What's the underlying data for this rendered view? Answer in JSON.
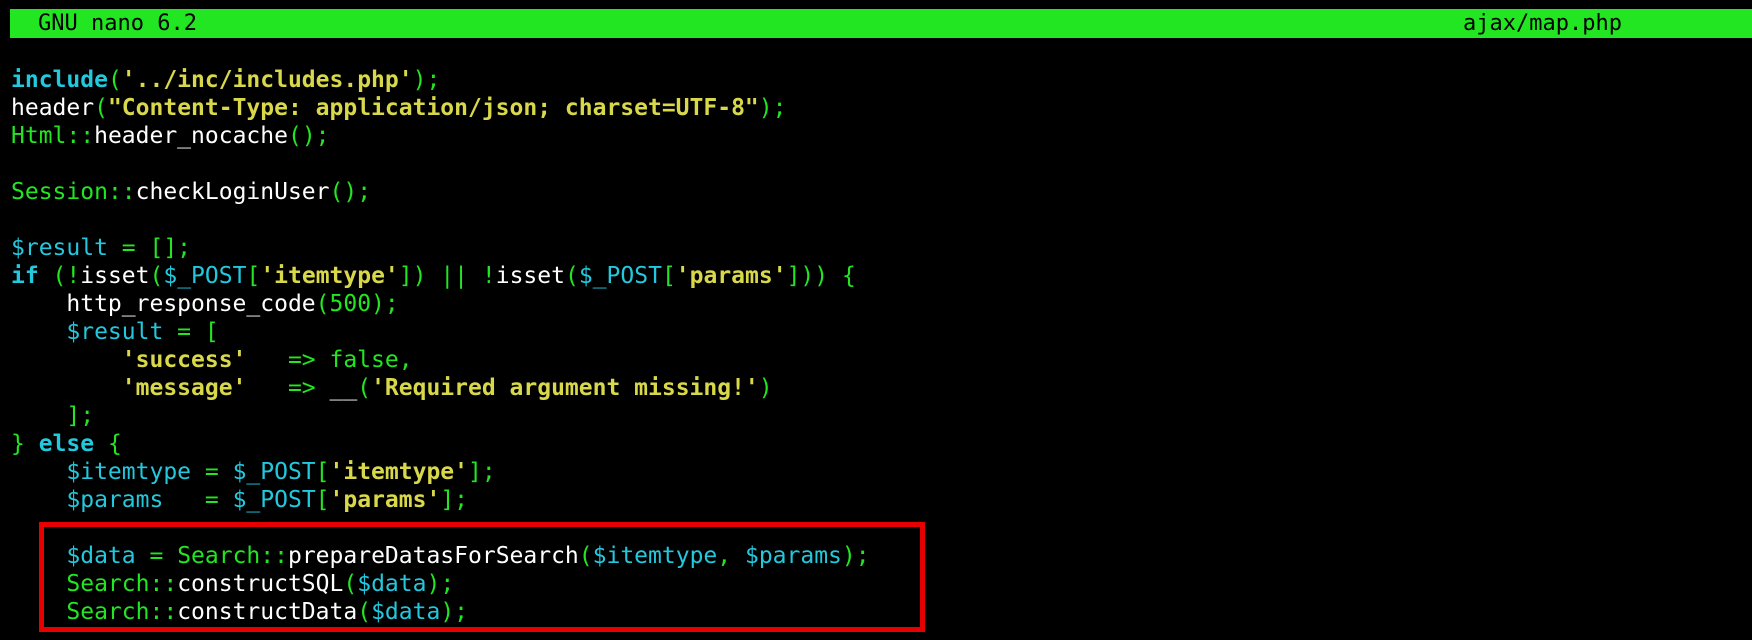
{
  "titlebar": {
    "app": "GNU nano 6.2",
    "filename": "ajax/map.php"
  },
  "colors": {
    "titlebar_bg": "#21e621",
    "keyword": "#22c9de",
    "variable": "#22c9de",
    "class": "#21e621",
    "string": "#d8d84a",
    "highlight_border": "#e60000"
  },
  "editor": {
    "lines": [
      [
        {
          "t": "include",
          "c": "kw"
        },
        {
          "t": "(",
          "c": "punc"
        },
        {
          "t": "'../inc/includes.php'",
          "c": "str"
        },
        {
          "t": ");",
          "c": "punc"
        }
      ],
      [
        {
          "t": "header",
          "c": "fn"
        },
        {
          "t": "(",
          "c": "punc"
        },
        {
          "t": "\"Content-Type: application/json; charset=UTF-8\"",
          "c": "str"
        },
        {
          "t": ");",
          "c": "punc"
        }
      ],
      [
        {
          "t": "Html",
          "c": "cls"
        },
        {
          "t": "::",
          "c": "punc"
        },
        {
          "t": "header_nocache",
          "c": "fn"
        },
        {
          "t": "();",
          "c": "punc"
        }
      ],
      [],
      [
        {
          "t": "Session",
          "c": "cls"
        },
        {
          "t": "::",
          "c": "punc"
        },
        {
          "t": "checkLoginUser",
          "c": "fn"
        },
        {
          "t": "();",
          "c": "punc"
        }
      ],
      [],
      [
        {
          "t": "$result",
          "c": "var"
        },
        {
          "t": " = [];",
          "c": "punc"
        }
      ],
      [
        {
          "t": "if",
          "c": "kw"
        },
        {
          "t": " (!",
          "c": "punc"
        },
        {
          "t": "isset",
          "c": "fn"
        },
        {
          "t": "(",
          "c": "punc"
        },
        {
          "t": "$_POST",
          "c": "var"
        },
        {
          "t": "[",
          "c": "punc"
        },
        {
          "t": "'itemtype'",
          "c": "str"
        },
        {
          "t": "]) || !",
          "c": "punc"
        },
        {
          "t": "isset",
          "c": "fn"
        },
        {
          "t": "(",
          "c": "punc"
        },
        {
          "t": "$_POST",
          "c": "var"
        },
        {
          "t": "[",
          "c": "punc"
        },
        {
          "t": "'params'",
          "c": "str"
        },
        {
          "t": "])) {",
          "c": "punc"
        }
      ],
      [
        {
          "t": "    ",
          "c": "fn"
        },
        {
          "t": "http_response_code",
          "c": "fn"
        },
        {
          "t": "(",
          "c": "punc"
        },
        {
          "t": "500",
          "c": "num"
        },
        {
          "t": ");",
          "c": "punc"
        }
      ],
      [
        {
          "t": "    ",
          "c": "fn"
        },
        {
          "t": "$result",
          "c": "var"
        },
        {
          "t": " = [",
          "c": "punc"
        }
      ],
      [
        {
          "t": "        ",
          "c": "fn"
        },
        {
          "t": "'success'",
          "c": "str"
        },
        {
          "t": "   => false,",
          "c": "punc"
        }
      ],
      [
        {
          "t": "        ",
          "c": "fn"
        },
        {
          "t": "'message'",
          "c": "str"
        },
        {
          "t": "   => ",
          "c": "punc"
        },
        {
          "t": "__",
          "c": "fn"
        },
        {
          "t": "(",
          "c": "punc"
        },
        {
          "t": "'Required argument missing!'",
          "c": "str"
        },
        {
          "t": ")",
          "c": "punc"
        }
      ],
      [
        {
          "t": "    ];",
          "c": "punc"
        }
      ],
      [
        {
          "t": "} ",
          "c": "punc"
        },
        {
          "t": "else",
          "c": "kw"
        },
        {
          "t": " {",
          "c": "punc"
        }
      ],
      [
        {
          "t": "    ",
          "c": "fn"
        },
        {
          "t": "$itemtype",
          "c": "var"
        },
        {
          "t": " = ",
          "c": "punc"
        },
        {
          "t": "$_POST",
          "c": "var"
        },
        {
          "t": "[",
          "c": "punc"
        },
        {
          "t": "'itemtype'",
          "c": "str"
        },
        {
          "t": "];",
          "c": "punc"
        }
      ],
      [
        {
          "t": "    ",
          "c": "fn"
        },
        {
          "t": "$params",
          "c": "var"
        },
        {
          "t": "   = ",
          "c": "punc"
        },
        {
          "t": "$_POST",
          "c": "var"
        },
        {
          "t": "[",
          "c": "punc"
        },
        {
          "t": "'params'",
          "c": "str"
        },
        {
          "t": "];",
          "c": "punc"
        }
      ],
      [],
      [
        {
          "t": "    ",
          "c": "fn"
        },
        {
          "t": "$data",
          "c": "var"
        },
        {
          "t": " = ",
          "c": "punc"
        },
        {
          "t": "Search",
          "c": "cls"
        },
        {
          "t": "::",
          "c": "punc"
        },
        {
          "t": "prepareDatasForSearch",
          "c": "fn"
        },
        {
          "t": "(",
          "c": "punc"
        },
        {
          "t": "$itemtype",
          "c": "var"
        },
        {
          "t": ", ",
          "c": "punc"
        },
        {
          "t": "$params",
          "c": "var"
        },
        {
          "t": ");",
          "c": "punc"
        }
      ],
      [
        {
          "t": "    ",
          "c": "fn"
        },
        {
          "t": "Search",
          "c": "cls"
        },
        {
          "t": "::",
          "c": "punc"
        },
        {
          "t": "constructSQL",
          "c": "fn"
        },
        {
          "t": "(",
          "c": "punc"
        },
        {
          "t": "$data",
          "c": "var"
        },
        {
          "t": ");",
          "c": "punc"
        }
      ],
      [
        {
          "t": "    ",
          "c": "fn"
        },
        {
          "t": "Search",
          "c": "cls"
        },
        {
          "t": "::",
          "c": "punc"
        },
        {
          "t": "constructData",
          "c": "fn"
        },
        {
          "t": "(",
          "c": "punc"
        },
        {
          "t": "$data",
          "c": "var"
        },
        {
          "t": ");",
          "c": "punc"
        }
      ]
    ]
  }
}
